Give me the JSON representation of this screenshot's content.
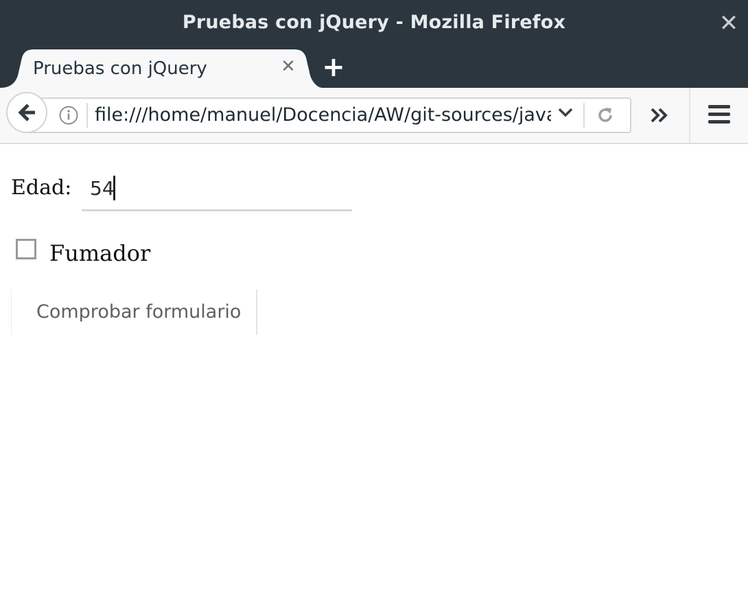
{
  "window": {
    "title": "Pruebas con jQuery - Mozilla Firefox",
    "close_glyph": "✕"
  },
  "tabs": [
    {
      "label": "Pruebas con jQuery",
      "close_glyph": "✕",
      "active": true
    }
  ],
  "new_tab_glyph": "+",
  "navbar": {
    "url": "file:///home/manuel/Docencia/AW/git-sources/javas",
    "icons": [
      "back-icon",
      "info-icon",
      "dropdown-icon",
      "reload-icon",
      "overflow-icon",
      "menu-icon"
    ]
  },
  "form": {
    "edad_label": "Edad:",
    "edad_value": "54",
    "fumador_label": "Fumador",
    "fumador_checked": false,
    "submit_label": "Comprobar formulario"
  }
}
